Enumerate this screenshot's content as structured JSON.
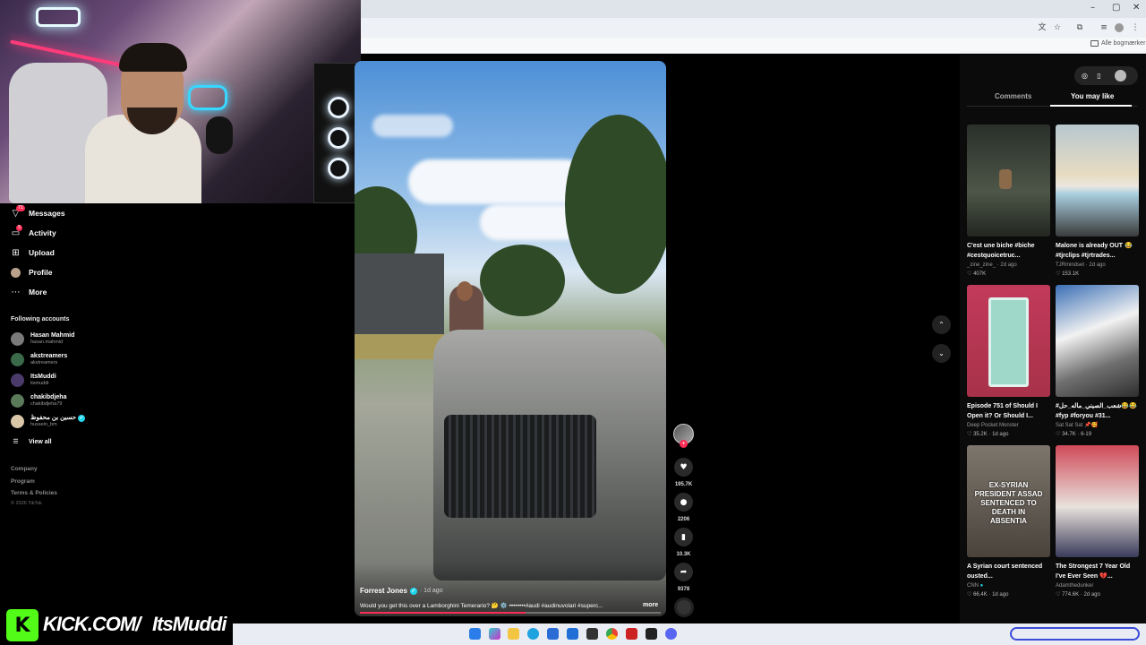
{
  "browser": {
    "bookmarks_label": "Alle bogmærker",
    "window_controls": [
      "–",
      "▢",
      "✕"
    ]
  },
  "sidebar": {
    "items": [
      {
        "label": "Messages",
        "icon": "paper-plane-icon",
        "badge": "71"
      },
      {
        "label": "Activity",
        "icon": "inbox-icon",
        "badge": "5"
      },
      {
        "label": "Upload",
        "icon": "plus-square-icon"
      },
      {
        "label": "Profile",
        "icon": "avatar-icon"
      },
      {
        "label": "More",
        "icon": "ellipsis-icon"
      }
    ],
    "following_title": "Following accounts",
    "accounts": [
      {
        "name": "Hasan Mahmid",
        "handle": "hasan.mahmid"
      },
      {
        "name": "akstreamers",
        "handle": "akstreamers"
      },
      {
        "name": "ItsMuddi",
        "handle": "itsmuddi"
      },
      {
        "name": "chakibdjeha",
        "handle": "chakibdjeha79"
      },
      {
        "name": "حسين بن محفوظ",
        "handle": "hussein_bm"
      }
    ],
    "view_all": "View all",
    "footer_links": [
      "Company",
      "Program",
      "Terms & Policies"
    ],
    "copyright": "© 2026 TikTok"
  },
  "video": {
    "author": "Forrest Jones",
    "time": "· 1d ago",
    "caption": "Would you get this over a Lamborghini Temerario? 🤔 ⚙️ ••••••••#audi #audinuvolari #superc...",
    "more_label": "more",
    "progress": 0.55
  },
  "actions": {
    "likes": "195.7K",
    "comments": "2206",
    "saves": "10.3K",
    "shares": "9378"
  },
  "right_panel": {
    "tabs": [
      "Comments",
      "You may like"
    ],
    "active_tab": 1,
    "cards": [
      {
        "title": "C'est une biche #biche #cestquoicetruc...",
        "author": "_zine_zine_",
        "age": "2d ago",
        "likes": "407K",
        "overlay": "",
        "bg": "#3d443a"
      },
      {
        "title": "Malone is already OUT 😂 #tjrclips #tjrtrades...",
        "author": "TJRmindset",
        "age": "2d ago",
        "likes": "153.1K",
        "overlay": "",
        "bg": "#c9b29a"
      },
      {
        "title": "Episode 751 of Should I Open it? Or Should I...",
        "author": "Deep Pocket Monster",
        "age": "1d ago",
        "likes": "35.2K",
        "overlay": "",
        "bg": "#a8324a"
      },
      {
        "title": "#شعب_الصيني_ماله_حل😂😂 #fyp #foryou #31...",
        "author": "Sat Sat Sat 📌🥰",
        "age": "6-19",
        "likes": "34.7K",
        "overlay": "",
        "bg": "#6f8fb5"
      },
      {
        "title": "A Syrian court sentenced ousted...",
        "author": "CNN",
        "age": "1d ago",
        "likes": "66.4K",
        "overlay": "EX-SYRIAN PRESIDENT ASSAD SENTENCED TO DEATH IN ABSENTIA",
        "bg": "#5a5048"
      },
      {
        "title": "The Strongest 7 Year Old I've Ever Seen 💔...",
        "author": "Adamthedunker",
        "age": "2d ago",
        "likes": "774.6K",
        "overlay": "",
        "bg": "#b83a4a"
      }
    ]
  },
  "watermark": {
    "site": "KICK.COM/",
    "channel": "ItsMuddi"
  },
  "colors": {
    "accent": "#fe2c55",
    "kick_green": "#53fc18",
    "verified": "#20d5ec"
  }
}
